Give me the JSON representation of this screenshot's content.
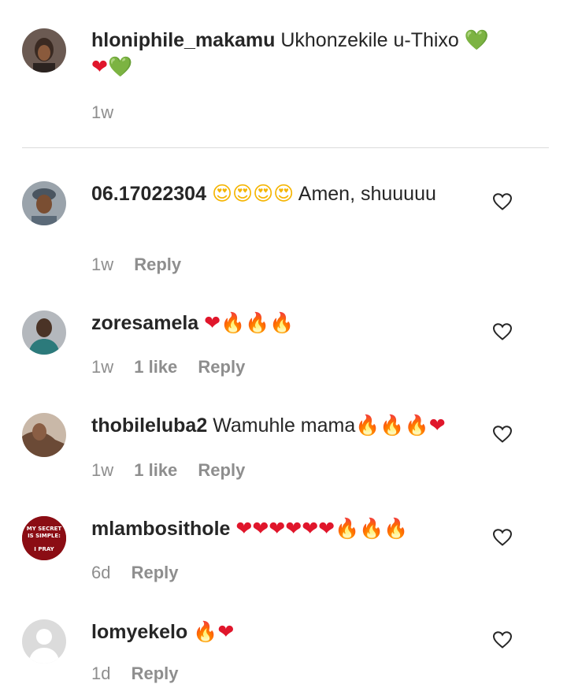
{
  "caption": {
    "username": "hloniphile_makamu",
    "text": "Ukhonzekile u-Thixo",
    "emojis": [
      "💚",
      "❤",
      "💚"
    ],
    "time": "1w"
  },
  "comments": [
    {
      "username": "06.17022304",
      "emoji_prefix": [
        "😍",
        "😍",
        "😍",
        "😍"
      ],
      "text": "Amen, shuuuuu",
      "time": "1w",
      "likes": "",
      "reply": "Reply"
    },
    {
      "username": "zoresamela",
      "emojis": [
        "❤",
        "🔥",
        "🔥",
        "🔥"
      ],
      "time": "1w",
      "likes": "1 like",
      "reply": "Reply"
    },
    {
      "username": "thobileluba2",
      "text": "Wamuhle mama",
      "emojis": [
        "🔥",
        "🔥",
        "🔥",
        "❤"
      ],
      "time": "1w",
      "likes": "1 like",
      "reply": "Reply"
    },
    {
      "username": "mlambosithole",
      "emojis": [
        "❤",
        "❤",
        "❤",
        "❤",
        "❤",
        "❤",
        "🔥",
        "🔥",
        "🔥"
      ],
      "time": "6d",
      "likes": "",
      "reply": "Reply",
      "avatar_text": [
        "MY SECRET",
        "IS SIMPLE:",
        "I PRAY"
      ]
    },
    {
      "username": "lomyekelo",
      "emojis": [
        "🔥",
        "❤"
      ],
      "time": "1d",
      "likes": "",
      "reply": "Reply"
    }
  ],
  "icons": {
    "like": "heart-outline-icon"
  },
  "colors": {
    "text": "#262626",
    "meta": "#8e8e8e",
    "divider": "#dbdbdb"
  }
}
